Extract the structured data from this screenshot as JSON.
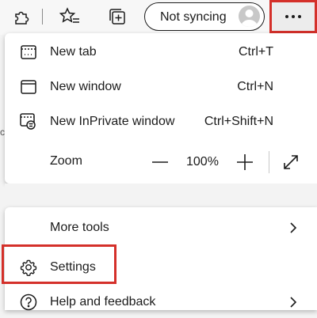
{
  "toolbar": {
    "sync_label": "Not syncing",
    "icons": [
      "extensions-icon",
      "favorites-icon",
      "collections-icon",
      "profile-avatar",
      "more-icon"
    ]
  },
  "menu": {
    "new_tab": {
      "label": "New tab",
      "shortcut": "Ctrl+T",
      "icon": "new-tab-icon"
    },
    "new_window": {
      "label": "New window",
      "shortcut": "Ctrl+N",
      "icon": "new-window-icon"
    },
    "new_inprivate": {
      "label": "New InPrivate window",
      "shortcut": "Ctrl+Shift+N",
      "icon": "inprivate-icon"
    },
    "zoom": {
      "label": "Zoom",
      "value": "100%",
      "minus": "—",
      "plus": "+"
    },
    "more_tools": {
      "label": "More tools"
    },
    "settings": {
      "label": "Settings",
      "icon": "gear-icon"
    },
    "help": {
      "label": "Help and feedback",
      "icon": "help-icon"
    }
  },
  "colors": {
    "highlight": "#d4302a",
    "menu_bg": "#ffffff",
    "page_bg": "#f3f3f3"
  }
}
